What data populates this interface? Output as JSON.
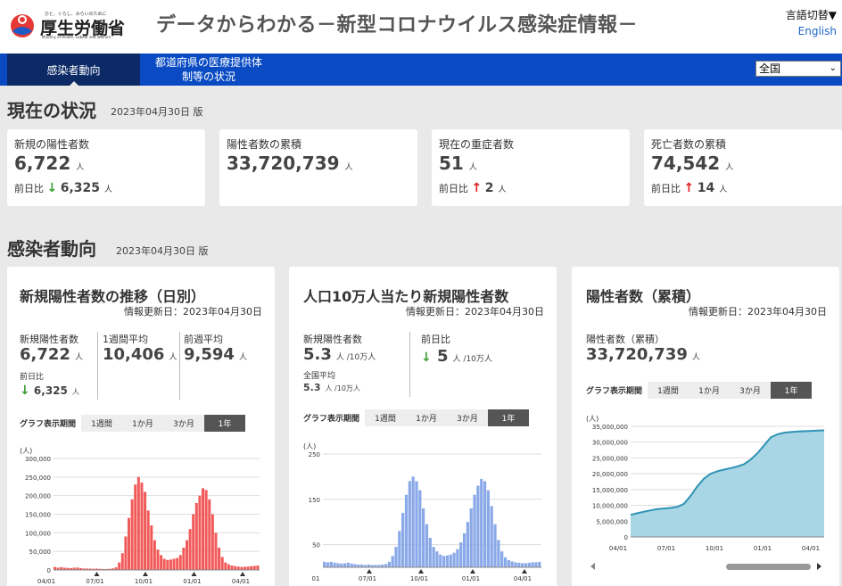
{
  "header": {
    "logo_tagline": "ひと、くらし、みらいのために",
    "logo_name": "厚生労働省",
    "logo_english": "Ministry of Health, Labour and Welfare",
    "title": "データからわかる－新型コロナウイルス感染症情報－",
    "lang_switch": "言語切替▼",
    "lang_english": "English"
  },
  "nav": {
    "tabs": [
      {
        "label": "感染者動向"
      },
      {
        "label_line1": "都道府県の医療提供体",
        "label_line2": "制等の状況"
      }
    ],
    "prefecture": "全国"
  },
  "current": {
    "title": "現在の状況",
    "date": "2023年04月30日 版",
    "cards": [
      {
        "label": "新規の陽性者数",
        "value": "6,722",
        "unit": "人",
        "diff_label": "前日比",
        "diff_arrow": "↓",
        "diff_value": "6,325",
        "diff_unit": "人"
      },
      {
        "label": "陽性者数の累積",
        "value": "33,720,739",
        "unit": "人"
      },
      {
        "label": "現在の重症者数",
        "value": "51",
        "unit": "人",
        "diff_label": "前日比",
        "diff_arrow": "↑",
        "diff_value": "2",
        "diff_unit": "人"
      },
      {
        "label": "死亡者数の累積",
        "value": "74,542",
        "unit": "人",
        "diff_label": "前日比",
        "diff_arrow": "↑",
        "diff_value": "14",
        "diff_unit": "人"
      }
    ]
  },
  "trend": {
    "title": "感染者動向",
    "date": "2023年04月30日 版",
    "period_label": "グラフ表示期間",
    "period_options": [
      "1週間",
      "1か月",
      "3か月",
      "1年"
    ],
    "cards": [
      {
        "title": "新規陽性者数の推移（日別）",
        "updated": "情報更新日：2023年04月30日",
        "m1_label": "新規陽性者数",
        "m1_value": "6,722",
        "m1_unit": "人",
        "m1_diff_label": "前日比",
        "m1_diff_arrow": "↓",
        "m1_diff_value": "6,325",
        "m1_diff_unit": "人",
        "m2_label": "1週間平均",
        "m2_value": "10,406",
        "m2_unit": "人",
        "m3_label": "前週平均",
        "m3_value": "9,594",
        "m3_unit": "人"
      },
      {
        "title": "人口10万人当たり新規陽性者数",
        "updated": "情報更新日：2023年04月30日",
        "m1_label": "新規陽性者数",
        "m1_value": "5.3",
        "m1_unit": "人 /10万人",
        "m1_sub_label": "全国平均",
        "m1_sub_value": "5.3",
        "m1_sub_unit": "人 /10万人",
        "m2_label": "前日比",
        "m2_arrow": "↓",
        "m2_value": "5",
        "m2_unit": "人 /10万人"
      },
      {
        "title": "陽性者数（累積）",
        "updated": "情報更新日：2023年04月30日",
        "m1_label": "陽性者数（累積）",
        "m1_value": "33,720,739",
        "m1_unit": "人"
      }
    ]
  },
  "chart_data": [
    {
      "type": "bar",
      "title": "新規陽性者数の推移（日別）",
      "ylabel": "(人)",
      "ylim": [
        0,
        300000
      ],
      "yticks": [
        "300,000",
        "250,000",
        "200,000",
        "150,000",
        "100,000",
        "50,000",
        "0"
      ],
      "xticks": [
        "04/01",
        "07/01",
        "10/01",
        "01/01",
        "04/01"
      ],
      "color": "#f25a5a",
      "values": [
        8000,
        6000,
        7500,
        6000,
        5500,
        5000,
        6000,
        6500,
        5000,
        4000,
        3800,
        3500,
        3200,
        3500,
        3000,
        2500,
        2500,
        3000,
        4000,
        7000,
        20000,
        45000,
        90000,
        140000,
        190000,
        230000,
        250000,
        235000,
        210000,
        160000,
        120000,
        80000,
        55000,
        40000,
        30000,
        27000,
        28000,
        30000,
        32000,
        40000,
        60000,
        80000,
        110000,
        150000,
        180000,
        200000,
        220000,
        215000,
        190000,
        150000,
        100000,
        60000,
        35000,
        20000,
        15000,
        12000,
        10000,
        9000,
        8000,
        8500,
        9000,
        10000,
        11000,
        12000
      ]
    },
    {
      "type": "bar",
      "title": "人口10万人当たり新規陽性者数",
      "ylabel": "(人)",
      "ylim": [
        0,
        250
      ],
      "yticks": [
        "250",
        "150",
        "50"
      ],
      "xticks": [
        "01",
        "07/01",
        "10/01",
        "01/01",
        "04/01"
      ],
      "color": "#8aa9e8",
      "values": [
        12,
        11,
        12,
        10,
        9,
        8,
        9,
        10,
        8,
        7,
        6,
        6,
        5,
        6,
        5,
        5,
        5,
        6,
        7,
        12,
        25,
        45,
        80,
        120,
        160,
        190,
        200,
        190,
        170,
        130,
        95,
        65,
        45,
        35,
        28,
        25,
        26,
        28,
        32,
        40,
        55,
        75,
        100,
        130,
        160,
        180,
        195,
        190,
        170,
        135,
        95,
        60,
        35,
        22,
        16,
        13,
        11,
        10,
        9,
        9,
        10,
        11,
        11,
        12
      ]
    },
    {
      "type": "area",
      "title": "陽性者数（累積）",
      "ylabel": "(人)",
      "ylim": [
        0,
        35000000
      ],
      "yticks": [
        "35,000,000",
        "30,000,000",
        "25,000,000",
        "20,000,000",
        "15,000,000",
        "10,000,000",
        "5,000,000",
        "0"
      ],
      "xticks": [
        "04/01",
        "07/01",
        "10/01",
        "01/01",
        "04/01"
      ],
      "color": "#5ab0c9",
      "values": [
        7000000,
        7500000,
        8000000,
        8400000,
        8800000,
        9000000,
        9200000,
        9500000,
        10500000,
        13000000,
        16000000,
        18500000,
        20000000,
        20800000,
        21300000,
        21800000,
        22300000,
        23000000,
        24500000,
        26500000,
        29000000,
        31500000,
        32500000,
        33000000,
        33200000,
        33350000,
        33450000,
        33550000,
        33650000,
        33720739
      ]
    }
  ]
}
